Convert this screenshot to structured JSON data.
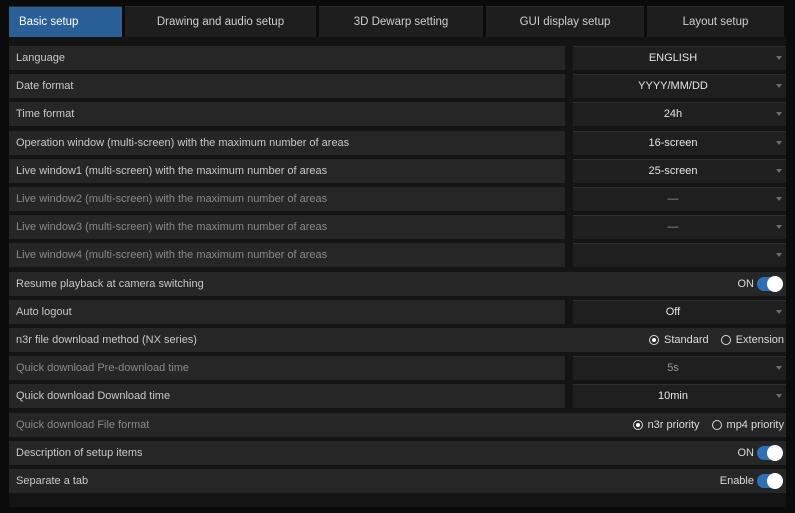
{
  "tabs": [
    {
      "label": "Basic setup"
    },
    {
      "label": "Drawing and audio setup"
    },
    {
      "label": "3D Dewarp setting"
    },
    {
      "label": "GUI display setup"
    },
    {
      "label": "Layout setup"
    }
  ],
  "rows": [
    {
      "label": "Language",
      "type": "select",
      "value": "ENGLISH"
    },
    {
      "label": "Date format",
      "type": "select",
      "value": "YYYY/MM/DD"
    },
    {
      "label": "Time format",
      "type": "select",
      "value": "24h"
    },
    {
      "label": "Operation window (multi-screen) with the maximum number of areas",
      "type": "select",
      "value": "16-screen"
    },
    {
      "label": "Live window1 (multi-screen) with the maximum number of areas",
      "type": "select",
      "value": "25-screen"
    },
    {
      "label": "Live window2 (multi-screen) with the maximum number of areas",
      "type": "select",
      "value": "—",
      "dim": true
    },
    {
      "label": "Live window3 (multi-screen) with the maximum number of areas",
      "type": "select",
      "value": "—",
      "dim": true
    },
    {
      "label": "Live window4 (multi-screen) with the maximum number of areas",
      "type": "select",
      "value": "",
      "dim": true
    },
    {
      "label": "Resume playback at camera switching",
      "type": "toggle",
      "value": "ON"
    },
    {
      "label": "Auto logout",
      "type": "select",
      "value": "Off"
    },
    {
      "label": "n3r file download method (NX series)",
      "type": "radio",
      "options": [
        "Standard",
        "Extension"
      ],
      "selected": 0
    },
    {
      "label": "Quick download Pre-download time",
      "type": "select",
      "value": "5s",
      "dim": true
    },
    {
      "label": "Quick download Download time",
      "type": "select",
      "value": "10min"
    },
    {
      "label": "Quick download File format",
      "type": "radio",
      "options": [
        "n3r priority",
        "mp4 priority"
      ],
      "selected": 0,
      "dim": true
    },
    {
      "label": "Description of setup items",
      "type": "toggle",
      "value": "ON"
    },
    {
      "label": "Separate a tab",
      "type": "toggle",
      "value": "Enable"
    }
  ],
  "colors": {
    "accent": "#2a5f97",
    "toggle_on": "#2f6fb6",
    "background": "#0b0b0b",
    "row": "#262626"
  }
}
